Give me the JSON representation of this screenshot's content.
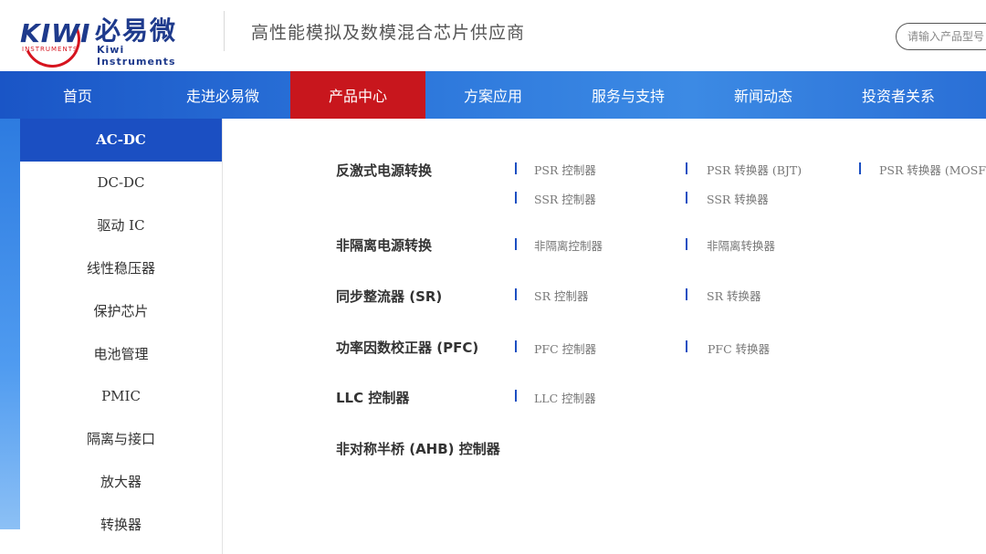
{
  "header": {
    "logo_text_kiwi": "KIWI",
    "logo_text_sub": "INSTRUMENTS",
    "logo_cn": "必易微",
    "logo_en": "Kiwi Instruments",
    "tagline": "高性能模拟及数模混合芯片供应商",
    "search_placeholder": "请输入产品型号"
  },
  "nav": {
    "items": [
      {
        "label": "首页"
      },
      {
        "label": "走进必易微"
      },
      {
        "label": "产品中心"
      },
      {
        "label": "方案应用"
      },
      {
        "label": "服务与支持"
      },
      {
        "label": "新闻动态"
      },
      {
        "label": "投资者关系"
      }
    ],
    "active": "产品中心"
  },
  "sidebar": {
    "items": [
      {
        "label": "AC-DC"
      },
      {
        "label": "DC-DC"
      },
      {
        "label": "驱动 IC"
      },
      {
        "label": "线性稳压器"
      },
      {
        "label": "保护芯片"
      },
      {
        "label": "电池管理"
      },
      {
        "label": "PMIC"
      },
      {
        "label": "隔离与接口"
      },
      {
        "label": "放大器"
      },
      {
        "label": "转换器"
      }
    ],
    "active": "AC-DC"
  },
  "content": {
    "categories": [
      {
        "title": "反激式电源转换",
        "links": [
          "PSR 控制器",
          "PSR 转换器 (BJT)",
          "PSR 转换器 (MOSFET)",
          "SSR 控制器",
          "SSR 转换器"
        ]
      },
      {
        "title": "非隔离电源转换",
        "links": [
          "非隔离控制器",
          "非隔离转换器"
        ]
      },
      {
        "title": "同步整流器 (SR)",
        "links": [
          "SR 控制器",
          "SR 转换器"
        ]
      },
      {
        "title": "功率因数校正器 (PFC)",
        "links": [
          "PFC 控制器",
          "PFC 转换器"
        ]
      },
      {
        "title": "LLC 控制器",
        "links": [
          "LLC 控制器"
        ]
      },
      {
        "title": "非对称半桥 (AHB) 控制器",
        "links": []
      }
    ]
  },
  "colors": {
    "brand_blue": "#1e3a8c",
    "brand_red": "#d6141f",
    "nav_active": "#c8161d",
    "sidebar_active": "#1b4fc2"
  }
}
